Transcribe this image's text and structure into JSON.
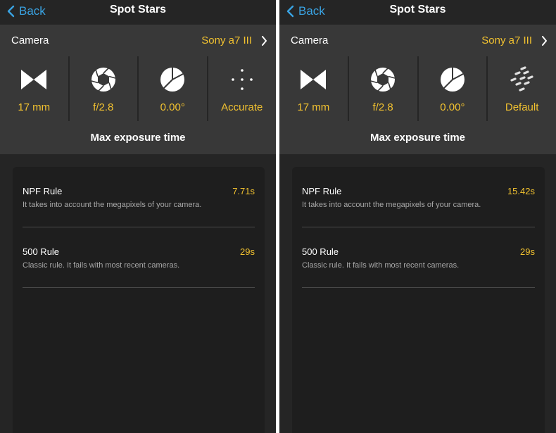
{
  "colors": {
    "accent": "#f2c230",
    "link": "#3aa3e3",
    "background": "#252525",
    "row": "#383838",
    "card": "#1e1e1e"
  },
  "panels": [
    {
      "nav": {
        "back_label": "Back",
        "title": "Spot Stars"
      },
      "camera": {
        "label": "Camera",
        "value": "Sony a7 III"
      },
      "params": [
        {
          "icon": "focal-length-icon",
          "value": "17 mm"
        },
        {
          "icon": "aperture-icon",
          "value": "f/2.8"
        },
        {
          "icon": "declination-pie-icon",
          "value": "0.00°"
        },
        {
          "icon": "accuracy-dots-icon",
          "value": "Accurate"
        }
      ],
      "section_title": "Max exposure time",
      "rules": [
        {
          "name": "NPF Rule",
          "value": "7.71s",
          "description": "It takes into account the megapixels of your camera."
        },
        {
          "name": "500 Rule",
          "value": "29s",
          "description": "Classic rule. It fails with most recent cameras."
        }
      ]
    },
    {
      "nav": {
        "back_label": "Back",
        "title": "Spot Stars"
      },
      "camera": {
        "label": "Camera",
        "value": "Sony a7 III"
      },
      "params": [
        {
          "icon": "focal-length-icon",
          "value": "17 mm"
        },
        {
          "icon": "aperture-icon",
          "value": "f/2.8"
        },
        {
          "icon": "declination-pie-icon",
          "value": "0.00°"
        },
        {
          "icon": "star-trail-icon",
          "value": "Default"
        }
      ],
      "section_title": "Max exposure time",
      "rules": [
        {
          "name": "NPF Rule",
          "value": "15.42s",
          "description": "It takes into account the megapixels of your camera."
        },
        {
          "name": "500 Rule",
          "value": "29s",
          "description": "Classic rule. It fails with most recent cameras."
        }
      ]
    }
  ]
}
